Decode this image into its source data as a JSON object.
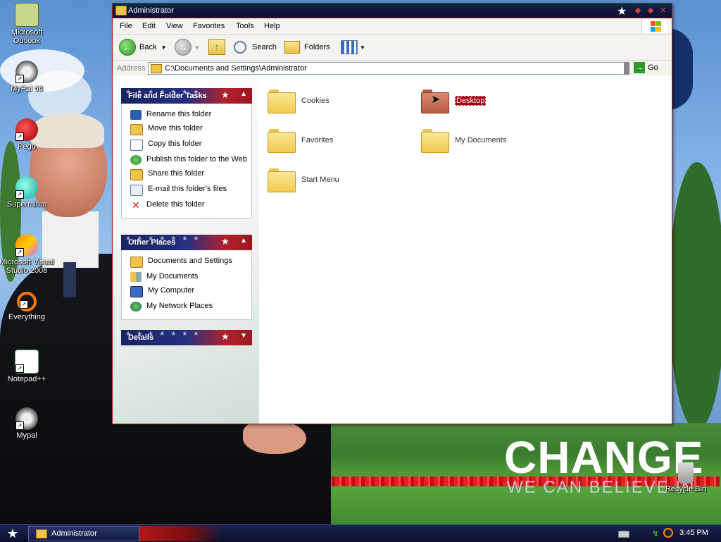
{
  "window": {
    "title": "Administrator",
    "menu": [
      "File",
      "Edit",
      "View",
      "Favorites",
      "Tools",
      "Help"
    ],
    "toolbar": {
      "back_label": "Back",
      "search_label": "Search",
      "folders_label": "Folders"
    },
    "address": {
      "label": "Address",
      "value": "C:\\Documents and Settings\\Administrator",
      "go_label": "Go"
    }
  },
  "tasks_panel": {
    "title": "File and Folder Tasks",
    "items": [
      {
        "label": "Rename this folder",
        "icon": "rename-icon"
      },
      {
        "label": "Move this folder",
        "icon": "move-icon"
      },
      {
        "label": "Copy this folder",
        "icon": "copy-icon"
      },
      {
        "label": "Publish this folder to the Web",
        "icon": "publish-web-icon"
      },
      {
        "label": "Share this folder",
        "icon": "share-icon"
      },
      {
        "label": "E-mail this folder's files",
        "icon": "email-icon"
      },
      {
        "label": "Delete this folder",
        "icon": "delete-icon"
      }
    ]
  },
  "places_panel": {
    "title": "Other Places",
    "items": [
      {
        "label": "Documents and Settings",
        "icon": "folder-icon"
      },
      {
        "label": "My Documents",
        "icon": "my-documents-icon"
      },
      {
        "label": "My Computer",
        "icon": "my-computer-icon"
      },
      {
        "label": "My Network Places",
        "icon": "network-places-icon"
      }
    ]
  },
  "details_panel": {
    "title": "Details"
  },
  "folders": [
    {
      "label": "Cookies",
      "selected": false
    },
    {
      "label": "Desktop",
      "selected": true
    },
    {
      "label": "Favorites",
      "selected": false
    },
    {
      "label": "My Documents",
      "selected": false
    },
    {
      "label": "Start Menu",
      "selected": false
    }
  ],
  "desktop_icons": [
    {
      "label": "Microsoft Outlook",
      "icon": "outlook-icon"
    },
    {
      "label": "MyPal 68",
      "icon": "mypal-icon"
    },
    {
      "label": "Pego",
      "icon": "pego-icon"
    },
    {
      "label": "Supermium",
      "icon": "supermium-icon"
    },
    {
      "label": "Microsoft Visual Studio 2008",
      "icon": "visual-studio-icon"
    },
    {
      "label": "Everything",
      "icon": "everything-icon"
    },
    {
      "label": "Notepad++",
      "icon": "notepadpp-icon"
    },
    {
      "label": "Mypal",
      "icon": "mypal-icon"
    },
    {
      "label": "Recycle Bin",
      "icon": "recycle-bin-icon"
    }
  ],
  "wallpaper": {
    "headline": "CHANGE",
    "tagline": "WE CAN BELIEVE IN"
  },
  "taskbar": {
    "window_button": "Administrator",
    "clock": "3:45 PM"
  },
  "colors": {
    "titlebar": "#0b0f33",
    "selection": "#a00010",
    "accent_red": "#b01818"
  }
}
